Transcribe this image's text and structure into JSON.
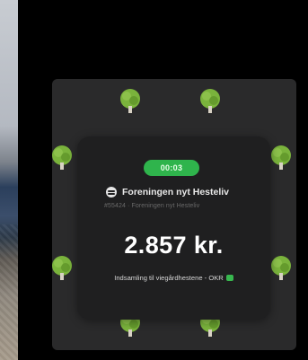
{
  "timer": "00:03",
  "org": {
    "name": "Foreningen nyt Hesteliv",
    "subtitle": "#55424 · Foreningen nyt Hesteliv"
  },
  "amount": "2.857 kr.",
  "description": "Indsamling til viegårdhestene - OKR",
  "colors": {
    "pill": "#2fb44c",
    "tree": "#7ab33c",
    "card": "#1f1f20",
    "panel": "#2a2a2b"
  },
  "icons": {
    "org": "menu-icon",
    "tree": "tree-icon",
    "description_end": "green-heart-icon"
  }
}
